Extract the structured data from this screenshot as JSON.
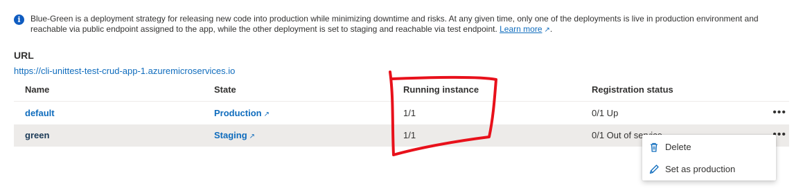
{
  "info": {
    "icon": "info-icon",
    "text": "Blue-Green is a deployment strategy for releasing new code into production while minimizing downtime and risks. At any given time, only one of the deployments is live in production environment and reachable via public endpoint assigned to the app, while the other deployment is set to staging and reachable via test endpoint.",
    "learn_more": "Learn more"
  },
  "url": {
    "label": "URL",
    "value": "https://cli-unittest-test-crud-app-1.azuremicroservices.io"
  },
  "table": {
    "headers": {
      "name": "Name",
      "state": "State",
      "running": "Running instance",
      "registration": "Registration status"
    },
    "rows": [
      {
        "name": "default",
        "state": "Production",
        "running": "1/1",
        "registration": "0/1 Up",
        "more": "•••"
      },
      {
        "name": "green",
        "state": "Staging",
        "running": "1/1",
        "registration": "0/1 Out of service",
        "more": "•••"
      }
    ]
  },
  "context_menu": {
    "items": [
      {
        "label": "Delete",
        "icon": "trash-icon"
      },
      {
        "label": "Set as production",
        "icon": "pencil-icon"
      }
    ]
  },
  "colors": {
    "link": "#0f6cbd",
    "annotation": "#e8111b",
    "selected_row": "#edebe9"
  }
}
